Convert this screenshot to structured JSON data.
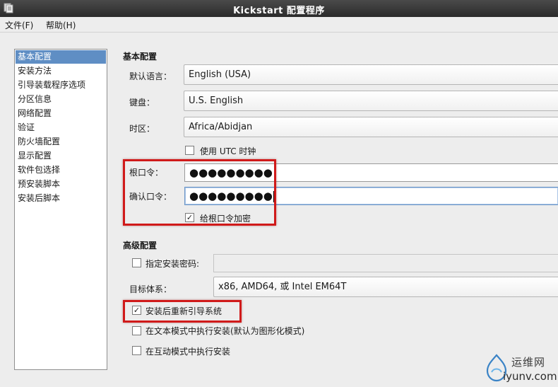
{
  "window": {
    "title": "Kickstart 配置程序"
  },
  "menu": [
    {
      "label": "文件(F)"
    },
    {
      "label": "帮助(H)"
    }
  ],
  "sidebar": {
    "selected_index": 0,
    "items": [
      {
        "label": "基本配置"
      },
      {
        "label": "安装方法"
      },
      {
        "label": "引导装载程序选项"
      },
      {
        "label": "分区信息"
      },
      {
        "label": "网络配置"
      },
      {
        "label": "验证"
      },
      {
        "label": "防火墙配置"
      },
      {
        "label": "显示配置"
      },
      {
        "label": "软件包选择"
      },
      {
        "label": "预安装脚本"
      },
      {
        "label": "安装后脚本"
      }
    ]
  },
  "basic": {
    "section_title": "基本配置",
    "language_label": "默认语言：",
    "language_value": "English (USA)",
    "keyboard_label": "键盘：",
    "keyboard_value": "U.S. English",
    "timezone_label": "时区：",
    "timezone_value": "Africa/Abidjan",
    "utc_label": "使用 UTC 时钟",
    "utc_checked": false,
    "root_pw_label": "根口令：",
    "root_pw_value": "●●●●●●●●●",
    "confirm_pw_label": "确认口令：",
    "confirm_pw_value": "●●●●●●●●●",
    "encrypt_label": "给根口令加密",
    "encrypt_checked": true
  },
  "advanced": {
    "section_title": "高级配置",
    "install_key_label": "指定安装密码:",
    "install_key_checked": false,
    "install_key_value": "",
    "target_arch_label": "目标体系：",
    "target_arch_value": "x86, AMD64, 或 Intel EM64T",
    "reboot_label": "安装后重新引导系统",
    "reboot_checked": true,
    "text_mode_label": "在文本模式中执行安装(默认为图形化模式)",
    "text_mode_checked": false,
    "interactive_label": "在互动模式中执行安装",
    "interactive_checked": false
  },
  "watermark": {
    "cn": "运维网",
    "en": "iyunv.com"
  },
  "colors": {
    "highlight": "#d01a1a",
    "selection": "#5f8ec4"
  }
}
